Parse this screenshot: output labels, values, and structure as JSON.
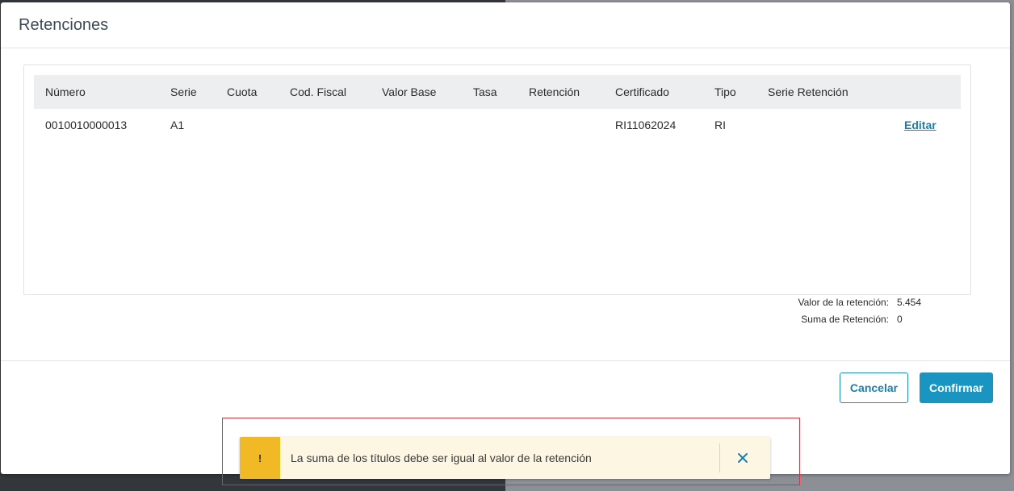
{
  "dialog": {
    "title": "Retenciones"
  },
  "table": {
    "headers": [
      "Número",
      "Serie",
      "Cuota",
      "Cod. Fiscal",
      "Valor Base",
      "Tasa",
      "Retención",
      "Certificado",
      "Tipo",
      "Serie Retención"
    ],
    "rows": [
      {
        "numero": "0010010000013",
        "serie": "A1",
        "cuota": "",
        "cod_fiscal": "",
        "valor_base": "",
        "tasa": "",
        "retencion": "",
        "certificado": "RI11062024",
        "tipo": "RI",
        "serie_retencion": "",
        "action": "Editar"
      }
    ]
  },
  "summary": {
    "valor_label": "Valor de la retención:",
    "valor_value": "5.454",
    "suma_label": "Suma de Retención:",
    "suma_value": "0"
  },
  "buttons": {
    "cancel": "Cancelar",
    "confirm": "Confirmar"
  },
  "toast": {
    "icon": "!",
    "icon_name": "warning-icon",
    "message": "La suma de los títulos debe ser igual al valor de la retención",
    "close_icon": "close-icon",
    "accent_color": "#f0b925",
    "background_color": "#fdf6e3"
  },
  "colors": {
    "primary": "#1a95c2",
    "link": "#1b7fae",
    "highlight_border": "#d9343b"
  }
}
